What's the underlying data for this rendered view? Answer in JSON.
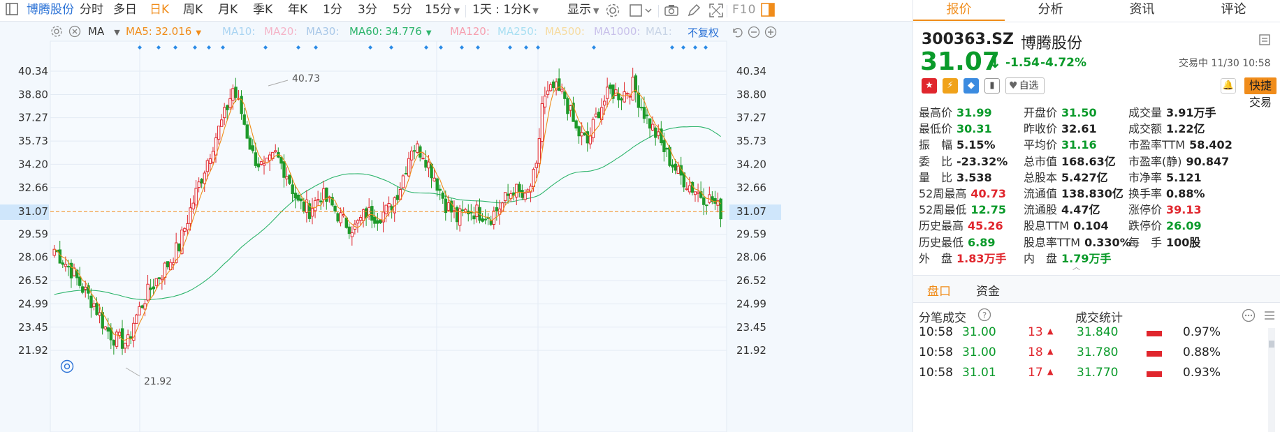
{
  "toolbar": {
    "stock_name": "博腾股份",
    "periods": [
      "分时",
      "多日",
      "日K",
      "周K",
      "月K",
      "季K",
      "年K",
      "1分",
      "3分",
      "5分",
      "15分"
    ],
    "active_period": "日K",
    "interval": "1天 : 1分K",
    "display": "显示",
    "f10": "F10"
  },
  "ma_legend": {
    "ma_label": "MA",
    "items": [
      {
        "label": "MA5:",
        "value": "32.016",
        "color": "#f08c1a"
      },
      {
        "label": "MA10:",
        "value": "",
        "color": "#a9d4f2"
      },
      {
        "label": "MA20:",
        "value": "",
        "color": "#f4b4c8"
      },
      {
        "label": "MA30:",
        "value": "",
        "color": "#a9c8e8"
      },
      {
        "label": "MA60:",
        "value": "34.776",
        "color": "#2db46c"
      },
      {
        "label": "MA120:",
        "value": "",
        "color": "#f6a0b0"
      },
      {
        "label": "MA250:",
        "value": "",
        "color": "#a8dff2"
      },
      {
        "label": "MA500:",
        "value": "",
        "color": "#f6dba0"
      },
      {
        "label": "MA1000:",
        "value": "",
        "color": "#c8c0ea"
      },
      {
        "label": "MA1:",
        "value": "",
        "color": "#c8d4e6"
      }
    ],
    "adjust": "不复权"
  },
  "chart_data": {
    "type": "candlestick",
    "y_ticks": [
      "40.34",
      "38.80",
      "37.27",
      "35.73",
      "34.20",
      "32.66",
      "31.07",
      "29.59",
      "28.06",
      "26.52",
      "24.99",
      "23.45",
      "21.92"
    ],
    "current_price_label": "31.07",
    "high_annotation": "40.73",
    "low_annotation": "21.92",
    "ylim": [
      21.92,
      40.34
    ],
    "colors": {
      "up": "#e0262d",
      "down": "#1e9a2a",
      "ma5": "#f08c1a",
      "ma60": "#2db46c",
      "current": "#f08c1a"
    }
  },
  "panel": {
    "tabs": [
      "报价",
      "分析",
      "资讯",
      "评论"
    ],
    "active_tab": "报价",
    "code": "300363.SZ",
    "name": "博腾股份",
    "price": "31.07",
    "arrow": "↓",
    "change": "-1.54",
    "change_pct": "-4.72%",
    "trade_time": "交易中 11/30 10:58",
    "watch_label": "自选",
    "quick_trade": "快捷交易",
    "stats": [
      [
        {
          "label": "最高价",
          "value": "31.99",
          "tone": "down"
        },
        {
          "label": "开盘价",
          "value": "31.50",
          "tone": "down"
        },
        {
          "label": "成交量",
          "value": "3.91万手",
          "tone": "neutral"
        }
      ],
      [
        {
          "label": "最低价",
          "value": "30.31",
          "tone": "down"
        },
        {
          "label": "昨收价",
          "value": "32.61",
          "tone": "neutral"
        },
        {
          "label": "成交额",
          "value": "1.22亿",
          "tone": "neutral"
        }
      ],
      [
        {
          "label": "振　幅",
          "value": "5.15%",
          "tone": "neutral"
        },
        {
          "label": "平均价",
          "value": "31.16",
          "tone": "down"
        },
        {
          "label": "市盈率TTM",
          "value": "58.402",
          "tone": "neutral"
        }
      ],
      [
        {
          "label": "委　比",
          "value": "-23.32%",
          "tone": "neutral"
        },
        {
          "label": "总市值",
          "value": "168.63亿",
          "tone": "neutral"
        },
        {
          "label": "市盈率(静)",
          "value": "90.847",
          "tone": "neutral"
        }
      ],
      [
        {
          "label": "量　比",
          "value": "3.538",
          "tone": "neutral"
        },
        {
          "label": "总股本",
          "value": "5.427亿",
          "tone": "neutral"
        },
        {
          "label": "市净率",
          "value": "5.121",
          "tone": "neutral"
        }
      ],
      [
        {
          "label": "52周最高",
          "value": "40.73",
          "tone": "up"
        },
        {
          "label": "流通值",
          "value": "138.830亿",
          "tone": "neutral"
        },
        {
          "label": "换手率",
          "value": "0.88%",
          "tone": "neutral"
        }
      ],
      [
        {
          "label": "52周最低",
          "value": "12.75",
          "tone": "down"
        },
        {
          "label": "流通股",
          "value": "4.47亿",
          "tone": "neutral"
        },
        {
          "label": "涨停价",
          "value": "39.13",
          "tone": "up"
        }
      ],
      [
        {
          "label": "历史最高",
          "value": "45.26",
          "tone": "up"
        },
        {
          "label": "股息TTM",
          "value": "0.104",
          "tone": "neutral"
        },
        {
          "label": "跌停价",
          "value": "26.09",
          "tone": "down"
        }
      ],
      [
        {
          "label": "历史最低",
          "value": "6.89",
          "tone": "down"
        },
        {
          "label": "股息率TTM",
          "value": "0.330%",
          "tone": "neutral"
        },
        {
          "label": "每　手",
          "value": "100股",
          "tone": "neutral"
        }
      ],
      [
        {
          "label": "外　盘",
          "value": "1.83万手",
          "tone": "up"
        },
        {
          "label": "内　盘",
          "value": "1.79万手",
          "tone": "down"
        }
      ]
    ],
    "sub_tabs": [
      "盘口",
      "资金"
    ],
    "active_sub_tab": "盘口",
    "ticks_title": "分笔成交",
    "stats_title": "成交统计",
    "ticks": [
      {
        "time": "10:58",
        "price": "31.00",
        "vol": "13"
      },
      {
        "time": "10:58",
        "price": "31.00",
        "vol": "18"
      },
      {
        "time": "10:58",
        "price": "31.01",
        "vol": "17"
      }
    ],
    "trade_stats": [
      {
        "price": "31.840",
        "pct": "0.97%"
      },
      {
        "price": "31.780",
        "pct": "0.88%"
      },
      {
        "price": "31.770",
        "pct": "0.93%"
      }
    ]
  }
}
